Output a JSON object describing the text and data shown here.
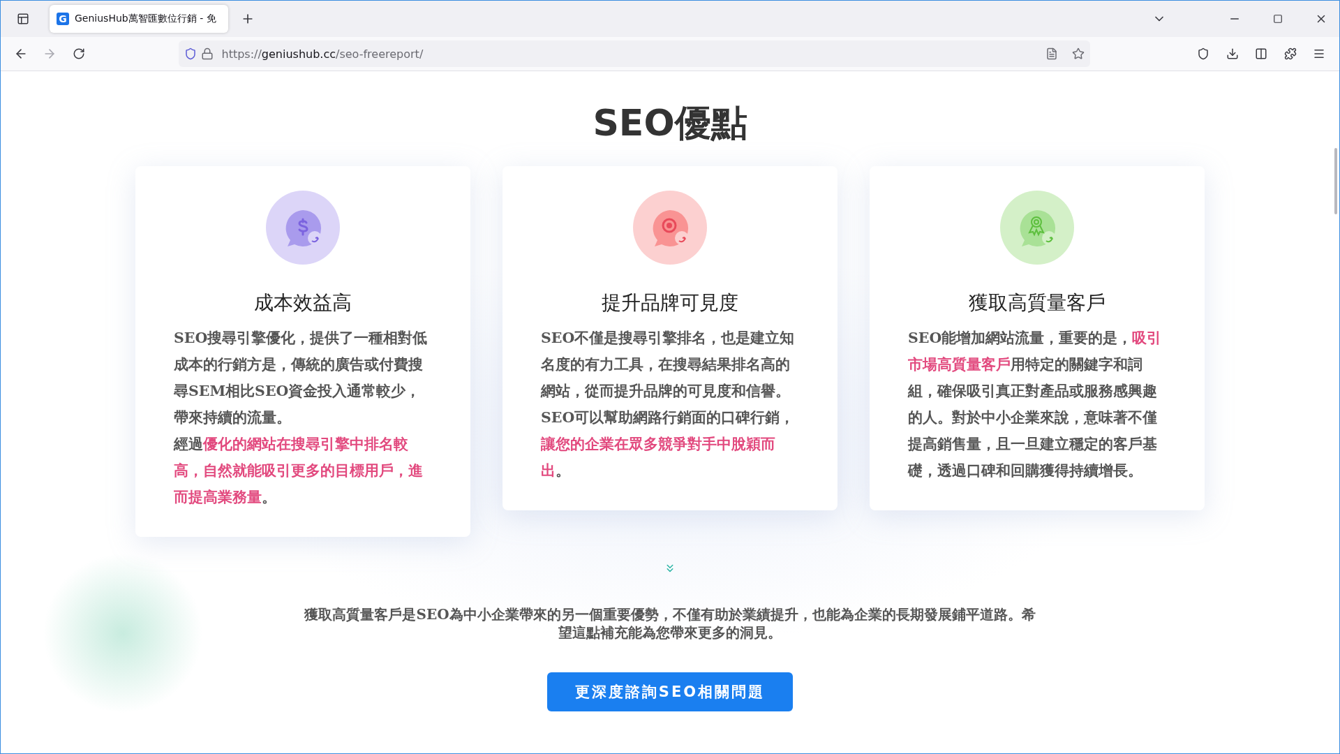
{
  "browser": {
    "tab": {
      "favicon": "G",
      "title": "GeniusHub萬智匯數位行銷 - 免",
      "selected": true
    },
    "url": {
      "scheme": "https://",
      "host": "geniushub.cc",
      "path": "/seo-freereport/"
    }
  },
  "page": {
    "heading": "SEO優點",
    "cards": [
      {
        "kind": "dollar",
        "title": "成本效益高",
        "paragraphs": [
          [
            {
              "text": "SEO搜尋引擎優化，提供了一種相對低成本的行銷方是，傳統的廣告或付費搜尋SEM相比SEO資金投入通常較少，帶來持續的流量。",
              "highlight": false
            }
          ],
          [
            {
              "text": "經過",
              "highlight": false
            },
            {
              "text": "優化的網站在搜尋引擎中排名較高，自然就能吸引更多的目標用戶，進而提高業務量",
              "highlight": true
            },
            {
              "text": "。",
              "highlight": false
            }
          ]
        ]
      },
      {
        "kind": "target",
        "title": "提升品牌可見度",
        "paragraphs": [
          [
            {
              "text": "SEO不僅是搜尋引擎排名，也是建立知名度的有力工具，在搜尋結果排名高的網站，從而提升品牌的可見度和信譽。SEO可以幫助網路行銷面的口碑行銷，",
              "highlight": false
            },
            {
              "text": "讓您的企業在眾多競爭對手中脫穎而出",
              "highlight": true
            },
            {
              "text": "。",
              "highlight": false
            }
          ]
        ]
      },
      {
        "kind": "award",
        "title": "獲取高質量客戶",
        "paragraphs": [
          [
            {
              "text": "SEO能增加網站流量，重要的是，",
              "highlight": false
            },
            {
              "text": "吸引市場高質量客戶",
              "highlight": true
            },
            {
              "text": "用特定的關鍵字和詞組，確保吸引真正對產品或服務感興趣的人。對於中小企業來說，意味著不僅提高銷售量，且一旦建立穩定的客戶基礎，透過口碑和回購獲得持續增長。",
              "highlight": false
            }
          ]
        ]
      }
    ],
    "summary": "獲取高質量客戶是SEO為中小企業帶來的另一個重要優勢，不僅有助於業績提升，也能為企業的長期發展鋪平道路。希望這點補充能為您帶來更多的洞見。",
    "cta": "更深度諮詢SEO相關問題"
  }
}
